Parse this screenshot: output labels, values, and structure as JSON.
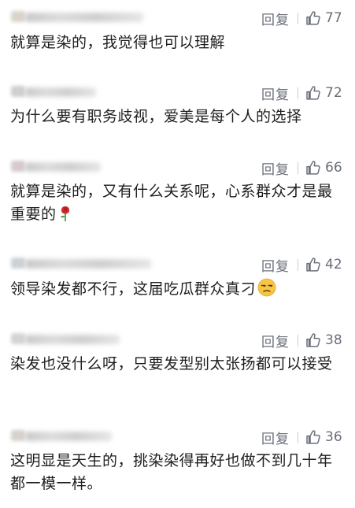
{
  "comments": [
    {
      "reply_label": "回复",
      "likes": "77",
      "text": "就算是染的，我觉得也可以理解",
      "emoji": null
    },
    {
      "reply_label": "回复",
      "likes": "72",
      "text": "为什么要有职务歧视，爱美是每个人的选择",
      "emoji": null
    },
    {
      "reply_label": "回复",
      "likes": "66",
      "text": "就算是染的，又有什么关系呢，心系群众才是最重要的",
      "emoji": "rose-emoji"
    },
    {
      "reply_label": "回复",
      "likes": "42",
      "text": "领导染发都不行，这届吃瓜群众真刁",
      "emoji": "unamused-face-emoji"
    },
    {
      "reply_label": "回复",
      "likes": "38",
      "text": "染发也没什么呀，只要发型别太张扬都可以接受",
      "emoji": null
    },
    {
      "reply_label": "回复",
      "likes": "36",
      "text": "这明显是天生的，挑染染得再好也做不到几十年都一模一样。",
      "emoji": null
    }
  ],
  "icons": {
    "like": "thumbs-up-outline-icon"
  },
  "colors": {
    "action_gray": "#6a6f7a",
    "text": "#1e1e1e",
    "background": "#ffffff"
  }
}
